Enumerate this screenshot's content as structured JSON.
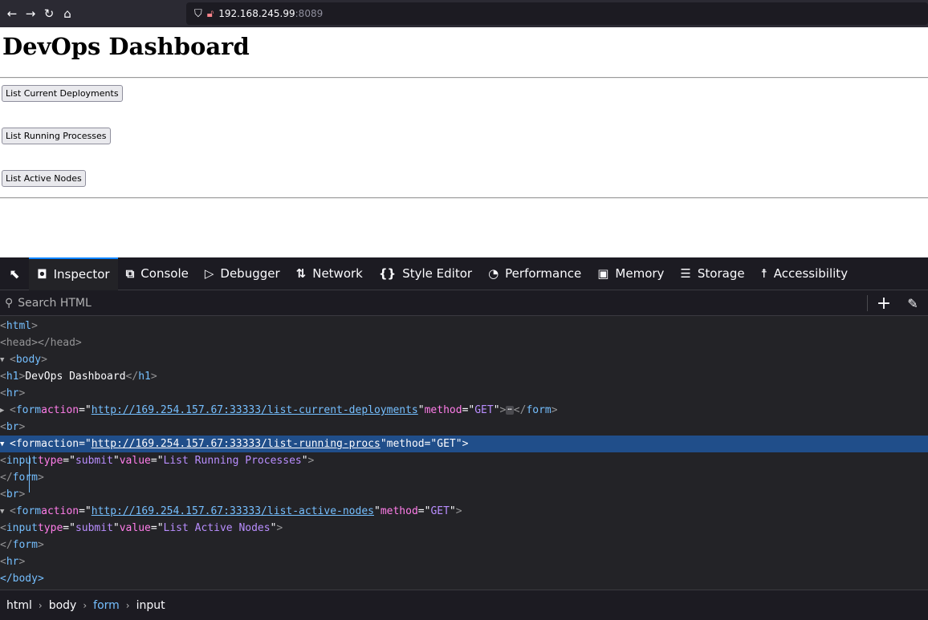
{
  "browser": {
    "url_host": "192.168.245.99",
    "url_port": ":8089"
  },
  "page": {
    "heading": "DevOps Dashboard",
    "buttons": [
      "List Current Deployments",
      "List Running Processes",
      "List Active Nodes"
    ]
  },
  "devtools": {
    "tabs": [
      "Inspector",
      "Console",
      "Debugger",
      "Network",
      "Style Editor",
      "Performance",
      "Memory",
      "Storage",
      "Accessibility"
    ],
    "search_placeholder": "Search HTML",
    "tree": {
      "html_open": "html",
      "head": "<head></head>",
      "body_open": "body",
      "h1_text": "DevOps Dashboard",
      "h1_tag": "h1",
      "hr": "hr",
      "br": "br",
      "form": "form",
      "input": "input",
      "action_attr": "action",
      "method_attr": "method",
      "type_attr": "type",
      "value_attr": "value",
      "method_val": "GET",
      "type_val": "submit",
      "url_base": "http://169.254.157.67:33333/",
      "url_deploy_path": "list-current-deployments",
      "url_procs_path": "list-running-procs",
      "url_nodes_path": "list-active-nodes",
      "input_procs_value": "List Running Processes",
      "input_nodes_value": "List Active Nodes",
      "body_close": "</body>"
    },
    "breadcrumbs": [
      "html",
      "body",
      "form",
      "input"
    ]
  }
}
